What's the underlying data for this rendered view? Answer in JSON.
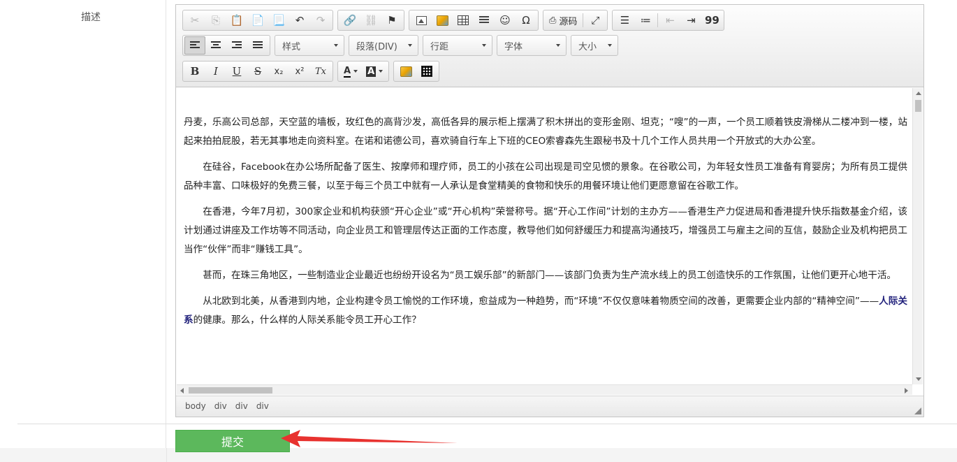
{
  "form": {
    "label": "描述"
  },
  "toolbar": {
    "source_label": "源码",
    "style_select": "样式",
    "paragraph_select": "段落(DIV)",
    "lineheight_select": "行距",
    "font_select": "字体",
    "size_select": "大小",
    "letters": {
      "bold": "B",
      "italic": "I",
      "underline": "U",
      "strike": "S",
      "sub": "x₂",
      "sup": "x²",
      "clear": "Tx",
      "fontcolor": "A",
      "bgcolor": "A",
      "omega": "Ω",
      "quote": "99"
    }
  },
  "content": {
    "p1": "丹麦，乐高公司总部，天空蓝的墙板，玫红色的高背沙发，高低各异的展示柜上摆满了积木拼出的变形金刚、坦克；“嗖”的一声，一个员工顺着铁皮滑梯从二楼冲到一楼，站起来拍拍屁股，若无其事地走向资料室。在诺和诺德公司，喜欢骑自行车上下班的CEO索睿森先生跟秘书及十几个工作人员共用一个开放式的大办公室。",
    "p2": "在硅谷，Facebook在办公场所配备了医生、按摩师和理疗师，员工的小孩在公司出现是司空见惯的景象。在谷歌公司，为年轻女性员工准备有育婴房；为所有员工提供品种丰富、口味极好的免费三餐，以至于每三个员工中就有一人承认是食堂精美的食物和快乐的用餐环境让他们更愿意留在谷歌工作。",
    "p3": "在香港，今年7月初，300家企业和机构获颁“开心企业”或“开心机构”荣誉称号。据“开心工作间”计划的主办方——香港生产力促进局和香港提升快乐指数基金介绍，该计划通过讲座及工作坊等不同活动，向企业员工和管理层传达正面的工作态度，教导他们如何舒缓压力和提高沟通技巧，增强员工与雇主之间的互信，鼓励企业及机构把员工当作“伙伴”而非“赚钱工具”。",
    "p4": "甚而，在珠三角地区，一些制造业企业最近也纷纷开设名为“员工娱乐部”的新部门——该部门负责为生产流水线上的员工创造快乐的工作氛围，让他们更开心地干活。",
    "p5_before": "从北欧到北美，从香港到内地，企业构建令员工愉悦的工作环境，愈益成为一种趋势，而“环境”不仅仅意味着物质空间的改善，更需要企业内部的“精神空间”——",
    "p5_link": "人际关系",
    "p5_after": "的健康。那么，什么样的人际关系能令员工开心工作？"
  },
  "statusbar": {
    "path": [
      "body",
      "div",
      "div",
      "div"
    ]
  },
  "submit": {
    "label": "提交"
  },
  "colors": {
    "submit_bg": "#5cb85c",
    "arrow": "#e8322f"
  }
}
